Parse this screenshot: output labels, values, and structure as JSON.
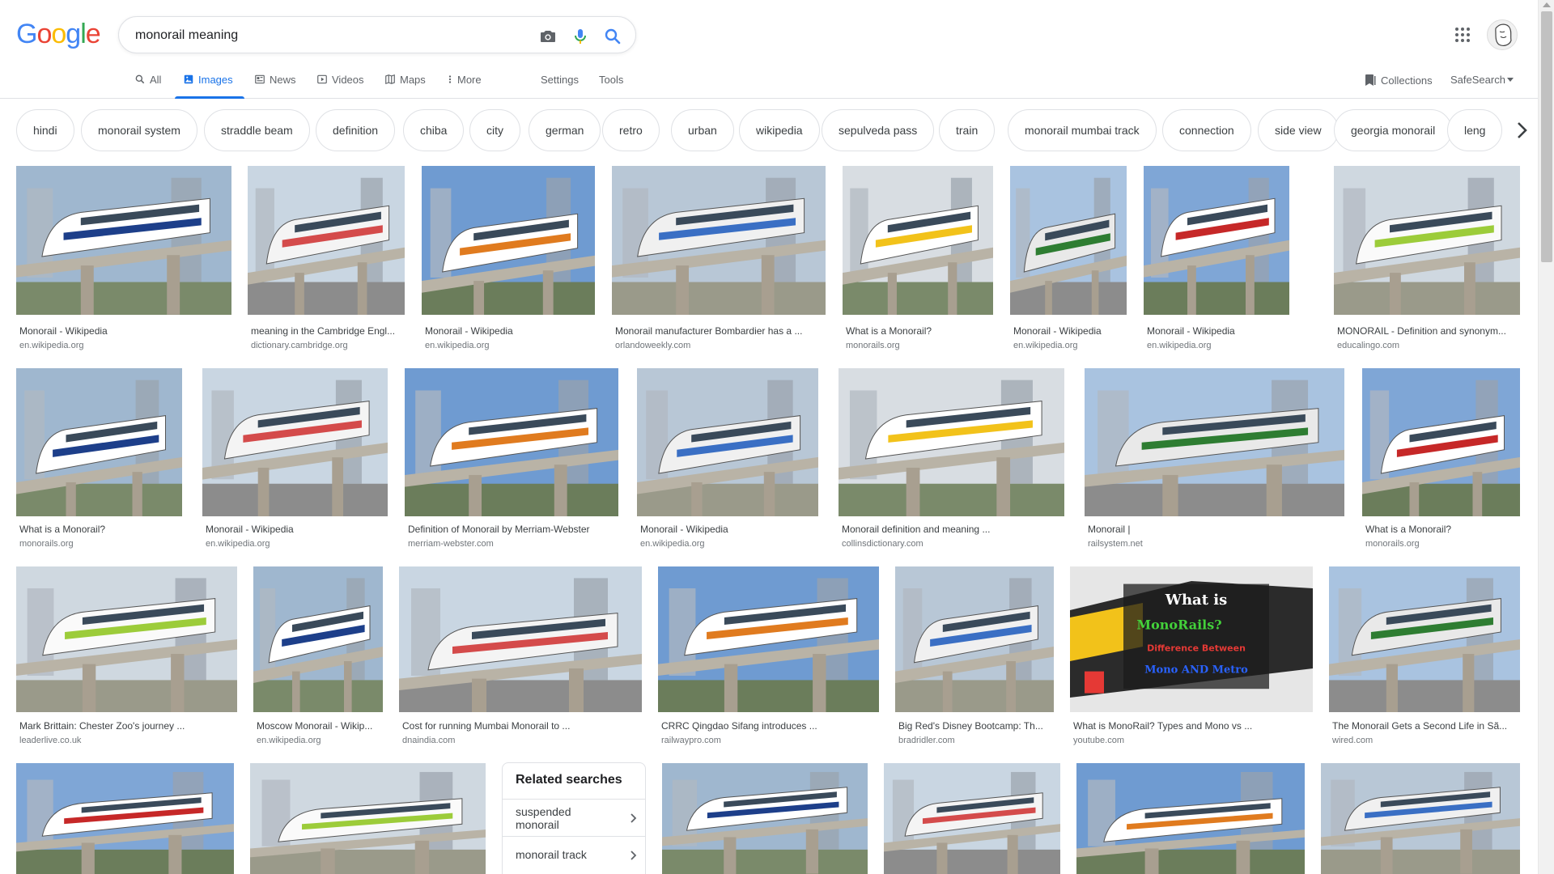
{
  "logo": {
    "letters": [
      "G",
      "o",
      "o",
      "g",
      "l",
      "e"
    ],
    "colors": [
      "#4285f4",
      "#ea4335",
      "#fbbc05",
      "#4285f4",
      "#34a853",
      "#ea4335"
    ]
  },
  "search": {
    "query": "monorail meaning"
  },
  "tabs": [
    {
      "label": "All",
      "icon": "search-icon"
    },
    {
      "label": "Images",
      "icon": "image-icon",
      "active": true
    },
    {
      "label": "News",
      "icon": "news-icon"
    },
    {
      "label": "Videos",
      "icon": "video-icon"
    },
    {
      "label": "Maps",
      "icon": "map-icon"
    },
    {
      "label": "More",
      "icon": "more-vert-icon"
    }
  ],
  "tools": {
    "settings": "Settings",
    "tools": "Tools",
    "collections": "Collections",
    "safesearch": "SafeSearch"
  },
  "chips": [
    "hindi",
    "monorail system",
    "straddle beam",
    "definition",
    "chiba",
    "city",
    "german",
    "retro",
    "urban",
    "wikipedia",
    "sepulveda pass",
    "train",
    "monorail mumbai track",
    "connection",
    "side view",
    "georgia monorail",
    "leng"
  ],
  "results": [
    {
      "title": "Monorail - Wikipedia",
      "source": "en.wikipedia.org"
    },
    {
      "title": "meaning in the Cambridge Engl...",
      "source": "dictionary.cambridge.org"
    },
    {
      "title": "Monorail - Wikipedia",
      "source": "en.wikipedia.org"
    },
    {
      "title": "Monorail manufacturer Bombardier has a ...",
      "source": "orlandoweekly.com"
    },
    {
      "title": "What is a Monorail?",
      "source": "monorails.org"
    },
    {
      "title": "Monorail - Wikipedia",
      "source": "en.wikipedia.org"
    },
    {
      "title": "Monorail - Wikipedia",
      "source": "en.wikipedia.org"
    },
    {
      "title": "MONORAIL - Definition and synonym...",
      "source": "educalingo.com"
    },
    {
      "title": "What is a Monorail?",
      "source": "monorails.org"
    },
    {
      "title": "Monorail - Wikipedia",
      "source": "en.wikipedia.org"
    },
    {
      "title": "Definition of Monorail by Merriam-Webster",
      "source": "merriam-webster.com"
    },
    {
      "title": "Monorail - Wikipedia",
      "source": "en.wikipedia.org"
    },
    {
      "title": "Monorail definition and meaning ...",
      "source": "collinsdictionary.com"
    },
    {
      "title": "Monorail |",
      "source": "railsystem.net"
    },
    {
      "title": "What is a Monorail?",
      "source": "monorails.org"
    },
    {
      "title": "Mark Brittain: Chester Zoo's journey ...",
      "source": "leaderlive.co.uk"
    },
    {
      "title": "Moscow Monorail - Wikip...",
      "source": "en.wikipedia.org"
    },
    {
      "title": "Cost for running Mumbai Monorail to ...",
      "source": "dnaindia.com"
    },
    {
      "title": "CRRC Qingdao Sifang introduces ...",
      "source": "railwaypro.com"
    },
    {
      "title": "Big Red's Disney Bootcamp: Th...",
      "source": "bradridler.com"
    },
    {
      "title": "What is MonoRail? Types and Mono vs ...",
      "source": "youtube.com"
    },
    {
      "title": "The Monorail Gets a Second Life in Sã...",
      "source": "wired.com"
    }
  ],
  "thumb_text": {
    "youtube_overlay": [
      "What is",
      "MonoRails?",
      "Difference Between",
      "Mono AND Metro"
    ]
  },
  "related": {
    "title": "Related searches",
    "items": [
      "suspended monorail",
      "monorail track"
    ]
  },
  "palette": {
    "accent": "#1a73e8",
    "muted": "#5f6368",
    "border": "#dfe1e5"
  }
}
